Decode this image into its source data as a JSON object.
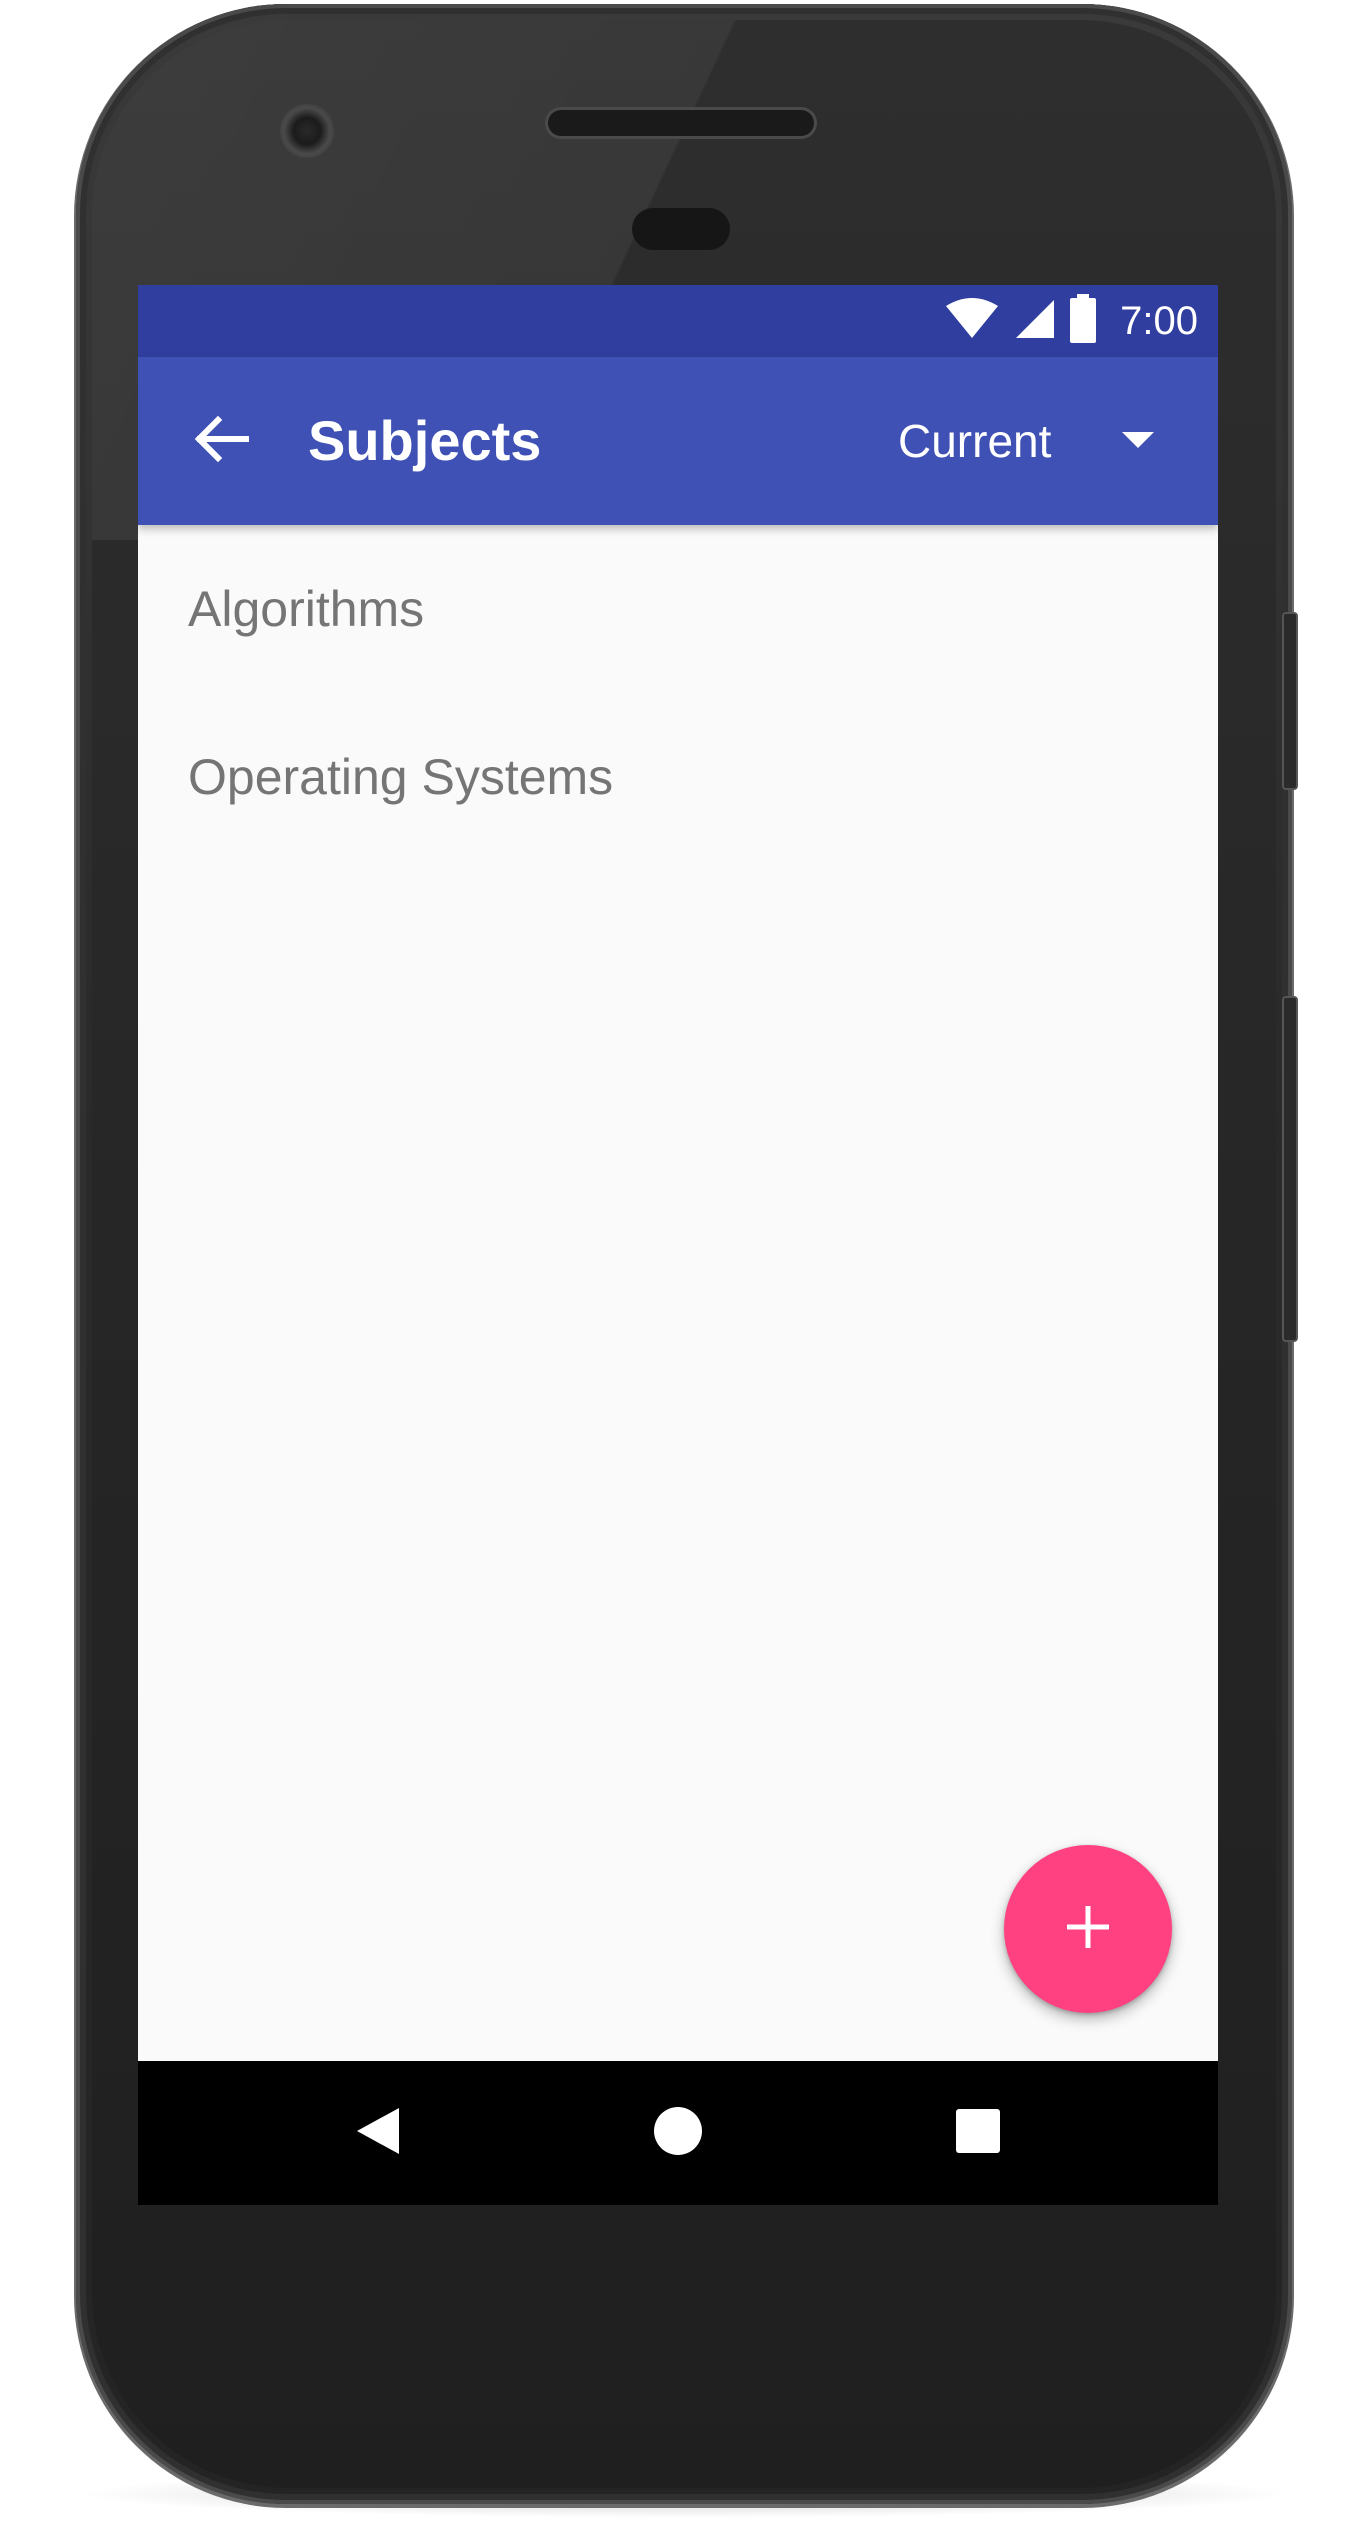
{
  "status_bar": {
    "time": "7:00",
    "icons": [
      "wifi-icon",
      "cellular-signal-icon",
      "battery-icon"
    ]
  },
  "app_bar": {
    "title": "Subjects",
    "back_icon": "arrow-back-icon",
    "filter_selected": "Current",
    "filter_icon": "dropdown-arrow-icon"
  },
  "subjects": [
    {
      "name": "Algorithms"
    },
    {
      "name": "Operating Systems"
    }
  ],
  "fab": {
    "icon": "plus-icon"
  },
  "nav_bar": {
    "buttons": [
      "back-triangle-icon",
      "home-circle-icon",
      "recents-square-icon"
    ]
  },
  "colors": {
    "primary": "#3f51b5",
    "primary_dark": "#303f9f",
    "accent": "#ff4081",
    "list_text": "#757575",
    "background": "#fafafa"
  }
}
